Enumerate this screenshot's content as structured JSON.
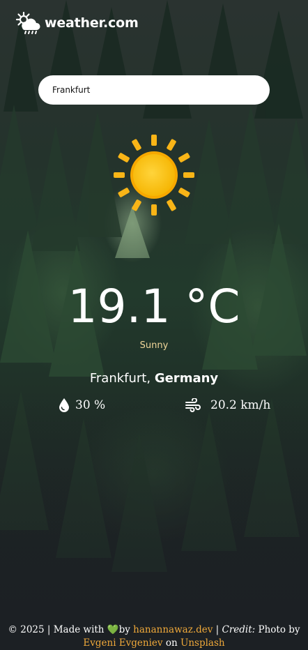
{
  "brand": {
    "name": "weather.com",
    "icon": "sun-cloud-rain-icon"
  },
  "search": {
    "value": "Frankfurt",
    "placeholder": ""
  },
  "weather": {
    "icon": "sun-icon",
    "temperature": "19.1 °C",
    "condition": "Sunny",
    "city": "Frankfurt,",
    "country": "Germany",
    "humidity": {
      "icon": "droplet-icon",
      "value": "30 %"
    },
    "wind": {
      "icon": "wind-icon",
      "value": "20.2 km/h"
    }
  },
  "footer": {
    "copyright": "© 2025 | Made with ",
    "heart": "💚",
    "by": "by ",
    "author_link": "hanannawaz.dev",
    "separator": " | ",
    "credit_label": "Credit:",
    "photo_by": " Photo by ",
    "photographer_link": "Evgeni Evgeniev",
    "on": " on ",
    "source_link": "Unsplash"
  },
  "colors": {
    "accent_link": "#f0a93a",
    "condition_text": "#f1d79a",
    "sun": "#fcc419"
  }
}
